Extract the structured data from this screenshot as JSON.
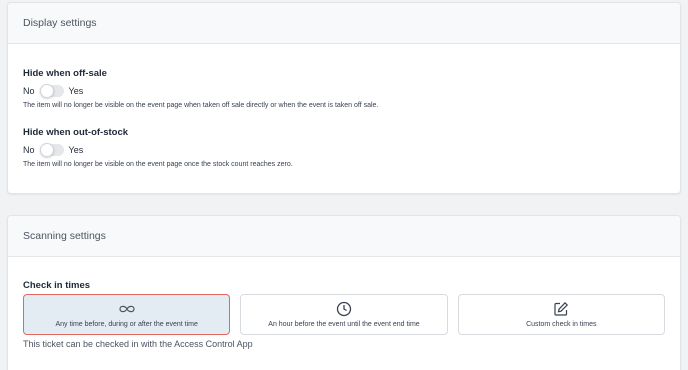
{
  "display_settings": {
    "header": "Display settings",
    "hide_off_sale": {
      "title": "Hide when off-sale",
      "no_label": "No",
      "yes_label": "Yes",
      "enabled": false,
      "description": "The item will no longer be visible on the event page when taken off sale directly or when the event is taken off sale."
    },
    "hide_out_of_stock": {
      "title": "Hide when out-of-stock",
      "no_label": "No",
      "yes_label": "Yes",
      "enabled": false,
      "description": "The item will no longer be visible on the event page once the stock count reaches zero."
    }
  },
  "scanning_settings": {
    "header": "Scanning settings",
    "check_in_title": "Check in times",
    "options": [
      {
        "label": "Any time before, during or after the event time",
        "icon": "infinity-icon",
        "selected": true
      },
      {
        "label": "An hour before the event until the event end time",
        "icon": "clock-icon",
        "selected": false
      },
      {
        "label": "Custom check in times",
        "icon": "edit-icon",
        "selected": false
      }
    ],
    "footer": "This ticket can be checked in with the Access Control App"
  },
  "colors": {
    "selected_border": "#e0685f",
    "selected_bg": "#e4ecf3",
    "page_bg": "#f1f2f4"
  }
}
